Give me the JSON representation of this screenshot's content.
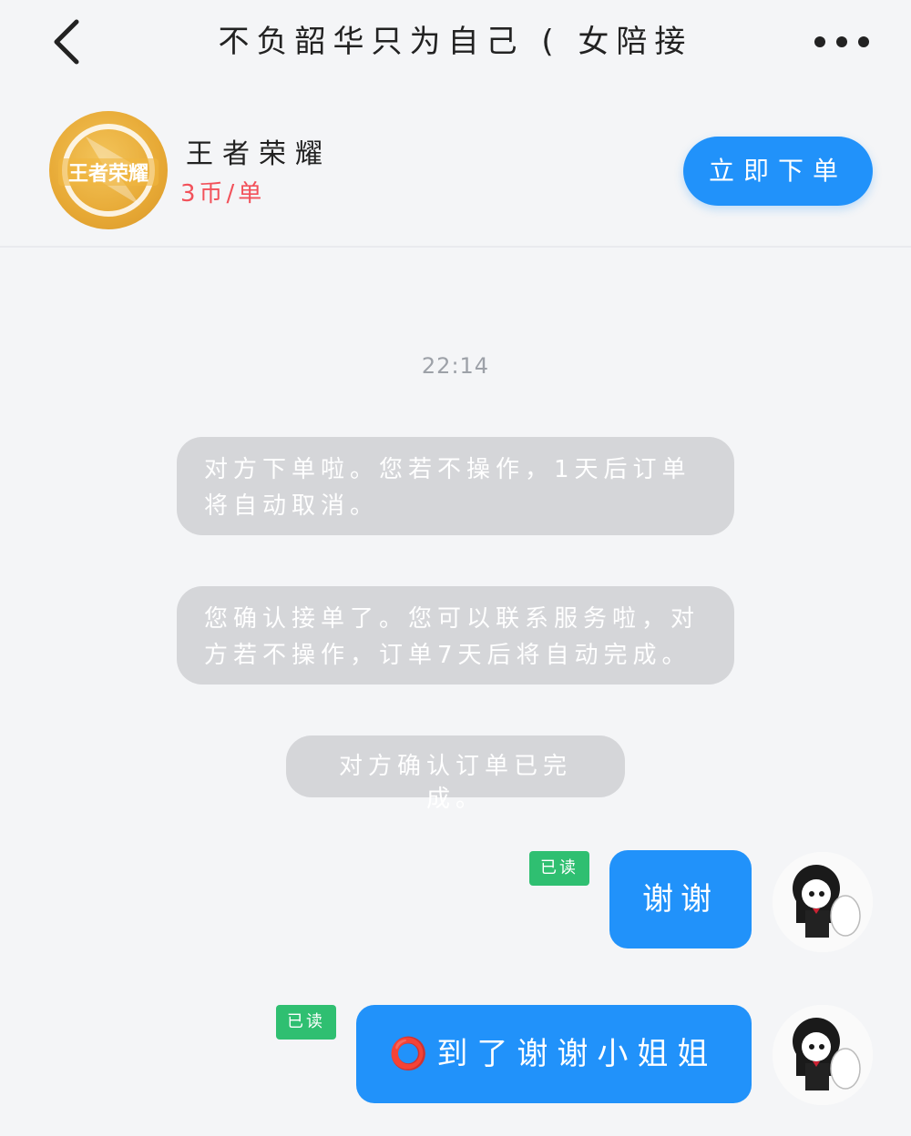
{
  "header": {
    "title": "不负韶华只为自己 ( 女陪接",
    "back_icon": "chevron-left-icon",
    "more_icon": "more-dots-icon"
  },
  "service": {
    "logo_text": "王者荣耀",
    "name": "王者荣耀",
    "price": "3币/单",
    "order_button": "立即下单",
    "accent_color": "#2192fa",
    "price_color": "#f2515a"
  },
  "chat": {
    "timestamp": "22:14",
    "system_messages": [
      "对方下单啦。您若不操作，1天后订单将自动取消。",
      "您确认接单了。您可以联系服务啦，对方若不操作，订单7天后将自动完成。",
      "对方确认订单已完成。"
    ],
    "messages": [
      {
        "text": "谢谢",
        "status": "已读"
      },
      {
        "emoji": "⭕",
        "text": "到了谢谢小姐姐",
        "status": "已读"
      }
    ]
  }
}
